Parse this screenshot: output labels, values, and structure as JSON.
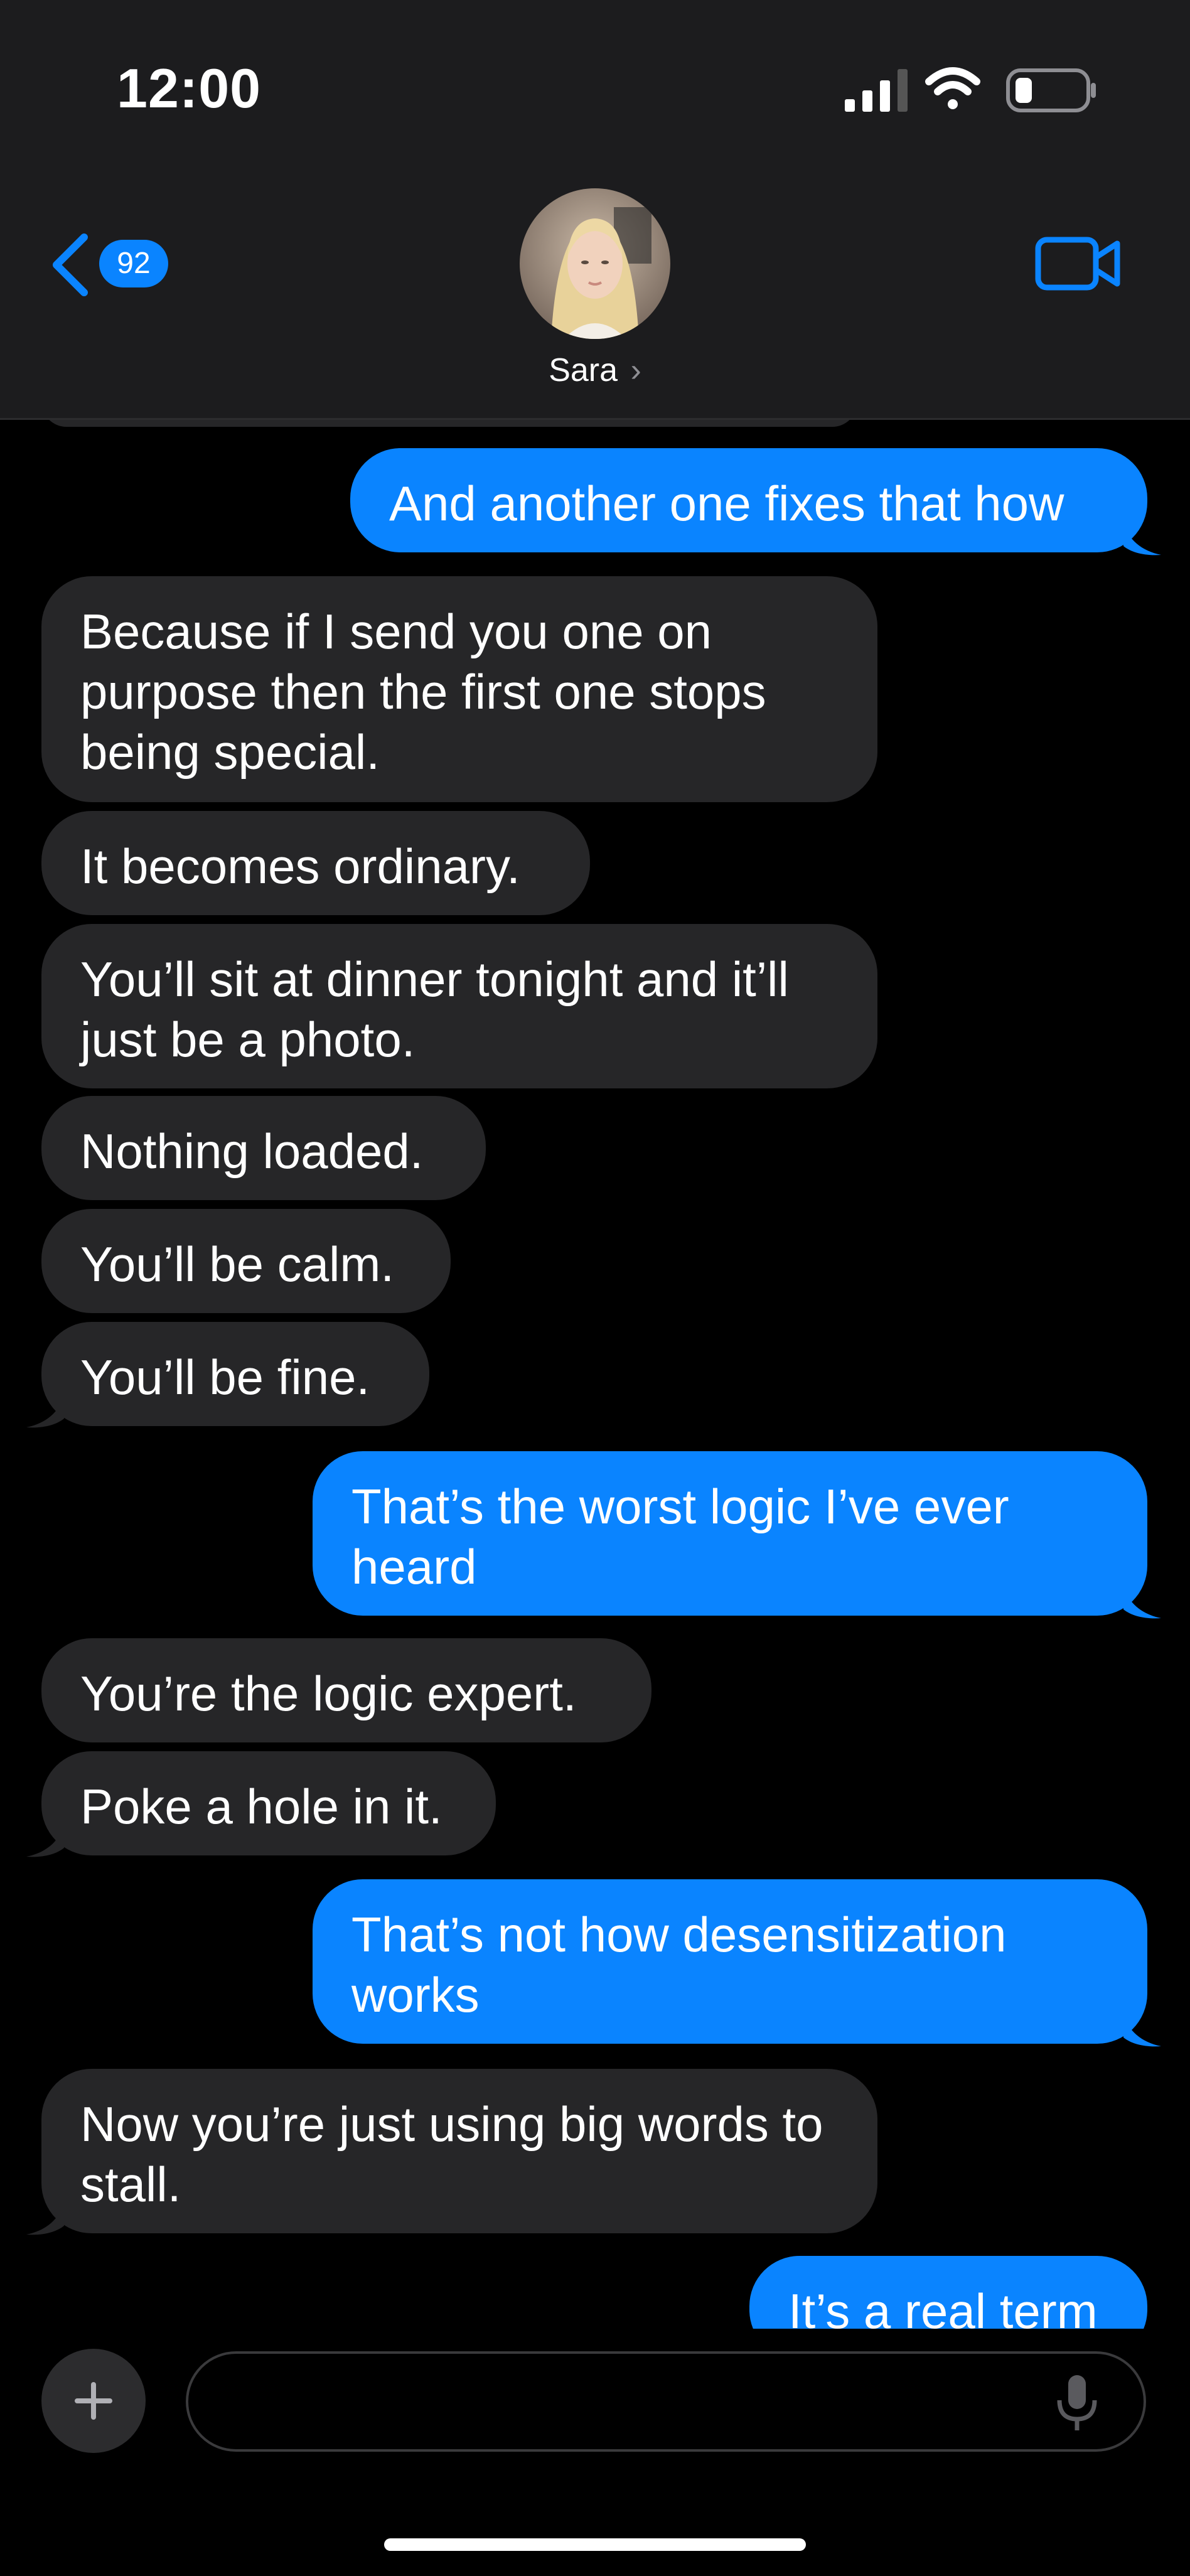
{
  "status_bar": {
    "time": "12:00"
  },
  "header": {
    "back_badge_count": "92",
    "contact_name": "Sara",
    "contact_chevron": "›"
  },
  "messages": [
    {
      "side": "sent",
      "text": "And another one fixes that how"
    },
    {
      "side": "received",
      "text": "Because if I send you one on purpose then the first one stops being special."
    },
    {
      "side": "received",
      "text": "It becomes ordinary."
    },
    {
      "side": "received",
      "text": "You’ll sit at dinner tonight and it’ll just be a photo."
    },
    {
      "side": "received",
      "text": "Nothing loaded."
    },
    {
      "side": "received",
      "text": "You’ll be calm."
    },
    {
      "side": "received",
      "text": "You’ll be fine."
    },
    {
      "side": "sent",
      "text": "That’s the worst logic I’ve ever heard"
    },
    {
      "side": "received",
      "text": "You’re the logic expert."
    },
    {
      "side": "received",
      "text": "Poke a hole in it."
    },
    {
      "side": "sent",
      "text": "That’s not how desensitization works"
    },
    {
      "side": "received",
      "text": "Now you’re just using big words to stall."
    },
    {
      "side": "sent",
      "text": "It’s a real term"
    }
  ],
  "composer": {
    "placeholder": ""
  },
  "colors": {
    "sent_bubble": "#0a84ff",
    "received_bubble": "#262628",
    "header_bg": "#1c1c1e"
  },
  "icons": [
    "signal-icon",
    "wifi-icon",
    "battery-icon",
    "back-chevron-icon",
    "video-camera-icon",
    "plus-icon",
    "microphone-icon"
  ]
}
